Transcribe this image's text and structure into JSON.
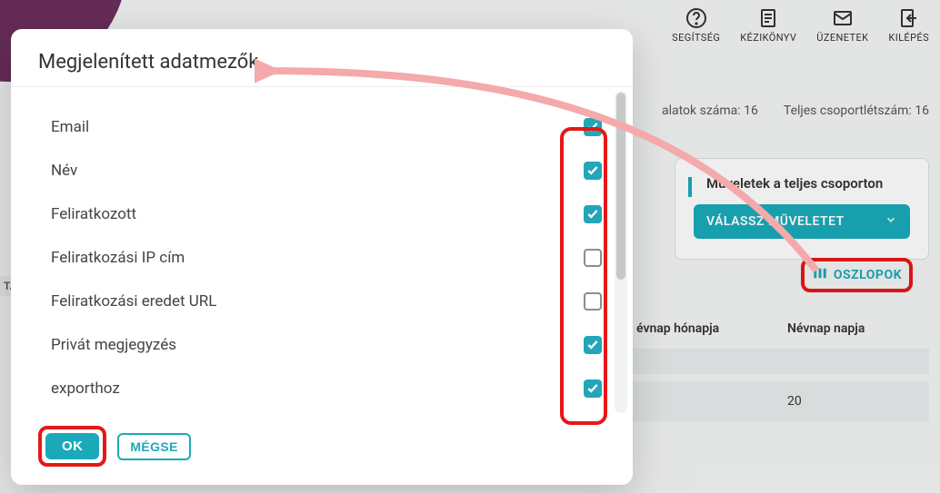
{
  "topbar": {
    "help": {
      "label": "SEGÍTSÉG"
    },
    "manual": {
      "label": "KÉZIKÖNYV"
    },
    "messages": {
      "label": "ÜZENETEK"
    },
    "logout": {
      "label": "KILÉPÉS"
    }
  },
  "counts": {
    "results": "alatok száma: 16",
    "total": "Teljes csoportlétszám: 16"
  },
  "side": {
    "title": "Műveletek a teljes csoporton",
    "dropdown_label": "VÁLASSZ MŰVELETET"
  },
  "columns_button": "OSZLOPOK",
  "table": {
    "col1_header": "évnap hónapja",
    "col2_header": "Névnap napja",
    "row1": {
      "c1": "",
      "c2": ""
    },
    "row2": {
      "c1": "",
      "c2": "20"
    }
  },
  "stub_tag": "TA",
  "modal": {
    "title": "Megjelenített adatmezők",
    "fields": [
      {
        "name": "Email",
        "checked": true
      },
      {
        "name": "Név",
        "checked": true
      },
      {
        "name": "Feliratkozott",
        "checked": true
      },
      {
        "name": "Feliratkozási IP cím",
        "checked": false
      },
      {
        "name": "Feliratkozási eredet URL",
        "checked": false
      },
      {
        "name": "Privát megjegyzés",
        "checked": true
      },
      {
        "name": "exporthoz",
        "checked": true
      }
    ],
    "ok_label": "OK",
    "cancel_label": "MÉGSE"
  }
}
